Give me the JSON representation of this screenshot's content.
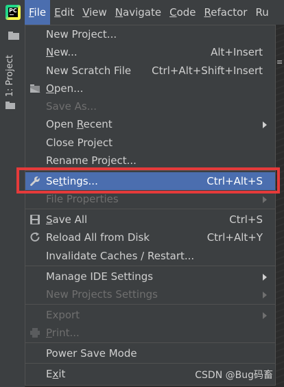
{
  "menubar": {
    "menus": [
      {
        "label": "File",
        "mnemonic": "F",
        "rest": "ile",
        "active": true
      },
      {
        "label": "Edit",
        "mnemonic": "E",
        "rest": "dit"
      },
      {
        "label": "View",
        "mnemonic": "V",
        "rest": "iew"
      },
      {
        "label": "Navigate",
        "mnemonic": "N",
        "rest": "avigate"
      },
      {
        "label": "Code",
        "mnemonic": "C",
        "rest": "ode"
      },
      {
        "label": "Refactor",
        "mnemonic": "R",
        "rest": "efactor"
      },
      {
        "label": "Ru",
        "mnemonic": "",
        "rest": "Ru"
      }
    ],
    "logo_text": "PC"
  },
  "tool_window": {
    "label": "1: Project"
  },
  "file_menu": {
    "items": [
      {
        "key": "new_project",
        "label": "New Project...",
        "shortcut": "",
        "enabled": true
      },
      {
        "key": "new",
        "pre": "",
        "mn": "N",
        "post": "ew...",
        "shortcut": "Alt+Insert",
        "enabled": true
      },
      {
        "key": "new_scratch",
        "label": "New Scratch File",
        "shortcut": "Ctrl+Alt+Shift+Insert",
        "enabled": true
      },
      {
        "key": "open",
        "pre": "",
        "mn": "O",
        "post": "pen...",
        "shortcut": "",
        "enabled": true,
        "icon": "folder-open-icon"
      },
      {
        "key": "save_as",
        "label": "Save As...",
        "shortcut": "",
        "enabled": false
      },
      {
        "key": "open_recent",
        "pre": "Open ",
        "mn": "R",
        "post": "ecent",
        "shortcut": "",
        "enabled": true,
        "submenu": true
      },
      {
        "key": "close_project",
        "label": "Close Project",
        "shortcut": "",
        "enabled": true
      },
      {
        "key": "rename_project",
        "label": "Rename Project...",
        "shortcut": "",
        "enabled": true
      },
      {
        "key": "settings",
        "pre": "Se",
        "mn": "t",
        "post": "tings...",
        "shortcut": "Ctrl+Alt+S",
        "enabled": true,
        "selected": true,
        "icon": "wrench-icon"
      },
      {
        "key": "file_properties",
        "label": "File Properties",
        "shortcut": "",
        "enabled": false,
        "submenu": true
      },
      {
        "key": "save_all",
        "pre": "",
        "mn": "S",
        "post": "ave All",
        "shortcut": "Ctrl+S",
        "enabled": true,
        "icon": "save-icon"
      },
      {
        "key": "reload",
        "label": "Reload All from Disk",
        "shortcut": "Ctrl+Alt+Y",
        "enabled": true,
        "icon": "reload-icon"
      },
      {
        "key": "invalidate",
        "label": "Invalidate Caches / Restart...",
        "shortcut": "",
        "enabled": true
      },
      {
        "key": "manage_ide",
        "label": "Manage IDE Settings",
        "shortcut": "",
        "enabled": true,
        "submenu": true
      },
      {
        "key": "new_projects_settings",
        "label": "New Projects Settings",
        "shortcut": "",
        "enabled": false,
        "submenu": true
      },
      {
        "key": "export",
        "label": "Export",
        "shortcut": "",
        "enabled": false,
        "submenu": true
      },
      {
        "key": "print",
        "pre": "",
        "mn": "P",
        "post": "rint...",
        "shortcut": "",
        "enabled": false,
        "icon": "print-icon"
      },
      {
        "key": "power_save",
        "label": "Power Save Mode",
        "shortcut": "",
        "enabled": true
      },
      {
        "key": "exit",
        "pre": "E",
        "mn": "x",
        "post": "it",
        "shortcut": "",
        "enabled": true
      }
    ]
  },
  "watermark": "CSDN @Bug码畜",
  "colors": {
    "menubar_bg": "#3c3f41",
    "selection": "#4b6eaf",
    "highlight_border": "#e53a3a",
    "text": "#d0d0d0",
    "disabled_text": "#6f6f6f"
  }
}
